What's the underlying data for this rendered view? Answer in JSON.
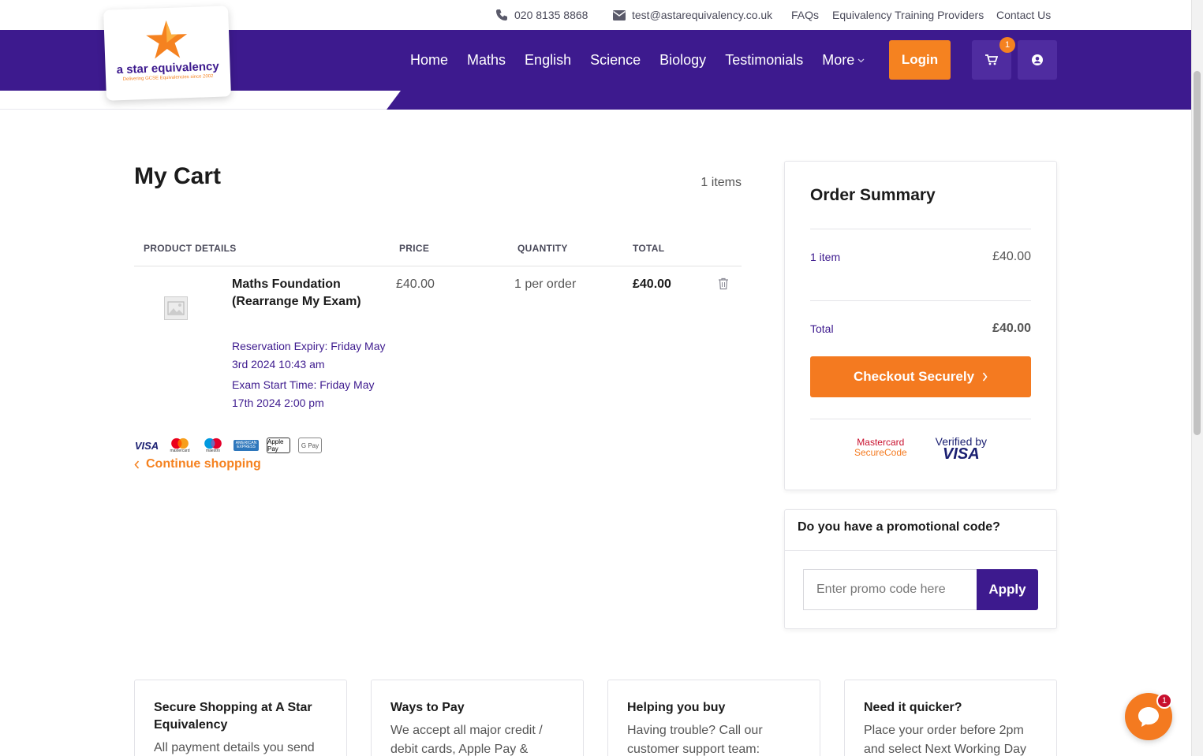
{
  "topbar": {
    "phone": "020 8135 8868",
    "email": "test@astarequivalency.co.uk",
    "links": [
      "FAQs",
      "Equivalency Training Providers",
      "Contact Us"
    ]
  },
  "logo": {
    "name": "a star equivalency",
    "tagline": "Delivering GCSE Equivalencies since 2002"
  },
  "nav": {
    "items": [
      "Home",
      "Maths",
      "English",
      "Science",
      "Biology",
      "Testimonials"
    ],
    "more_label": "More",
    "login_label": "Login",
    "cart_count": "1"
  },
  "cart": {
    "title": "My Cart",
    "item_count": "1 items",
    "headers": {
      "product": "PRODUCT DETAILS",
      "price": "PRICE",
      "quantity": "QUANTITY",
      "total": "TOTAL"
    },
    "item": {
      "name": "Maths Foundation (Rearrange My Exam)",
      "reservation": "Reservation Expiry: Friday May 3rd 2024 10:43 am",
      "exam_start": "Exam Start Time: Friday May 17th 2024 2:00 pm",
      "price": "£40.00",
      "quantity": "1 per order",
      "total": "£40.00"
    },
    "payment_icons": [
      "VISA",
      "mastercard",
      "maestro",
      "AMERICAN EXPRESS",
      "Apple Pay",
      "G Pay"
    ],
    "continue_label": "Continue shopping"
  },
  "summary": {
    "title": "Order Summary",
    "items_label": "1 item",
    "items_value": "£40.00",
    "total_label": "Total",
    "total_value": "£40.00",
    "checkout_label": "Checkout Securely",
    "mc_line1": "Mastercard",
    "mc_line2": "SecureCode",
    "visa_line1": "Verified by",
    "visa_line2": "VISA"
  },
  "promo": {
    "title": "Do you have a promotional code?",
    "placeholder": "Enter promo code here",
    "apply_label": "Apply"
  },
  "info_cards": [
    {
      "title": "Secure Shopping at A Star Equivalency",
      "text": "All payment details you send"
    },
    {
      "title": "Ways to Pay",
      "text": "We accept all major credit / debit cards, Apple Pay &"
    },
    {
      "title": "Helping you buy",
      "text": "Having trouble? Call our customer support team:"
    },
    {
      "title": "Need it quicker?",
      "text": "Place your order before 2pm and select Next Working Day"
    }
  ],
  "chat": {
    "badge": "1"
  },
  "colors": {
    "brand_purple": "#3d1a8e",
    "brand_orange": "#f58220"
  }
}
